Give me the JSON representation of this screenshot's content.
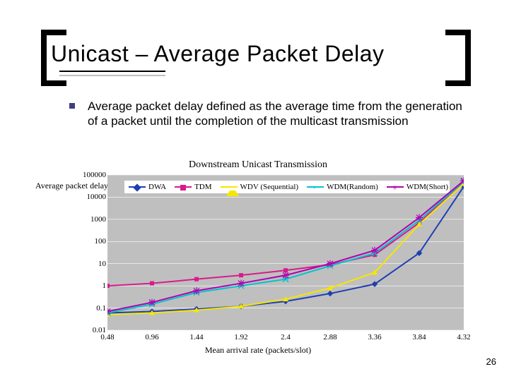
{
  "title": "Unicast – Average Packet Delay",
  "bullet_text": "Average packet delay defined as the average time from the generation of a packet until the completion of the multicast transmission",
  "page_number": "26",
  "chart_data": {
    "type": "line",
    "title": "Downstream Unicast Transmission",
    "xlabel": "Mean arrival rate (packets/slot)",
    "ylabel": "Average packet delay(us)",
    "yscale": "log",
    "ylim": [
      0.01,
      100000
    ],
    "yticks": [
      0.01,
      0.1,
      1,
      10,
      100,
      1000,
      10000,
      100000
    ],
    "ytick_labels": [
      "0.01",
      "0.1",
      "1",
      "10",
      "100",
      "1000",
      "10000",
      "100000"
    ],
    "xticks": [
      0.48,
      0.96,
      1.44,
      1.92,
      2.4,
      2.88,
      3.36,
      3.84,
      4.32
    ],
    "xtick_labels": [
      "0.48",
      "0.96",
      "1.44",
      "1.92",
      "2.4",
      "2.88",
      "3.36",
      "3.84",
      "4.32"
    ],
    "x": [
      0.48,
      0.96,
      1.44,
      1.92,
      2.4,
      2.88,
      3.36,
      3.84,
      4.32
    ],
    "series": [
      {
        "name": "DWA",
        "color": "#1f3fb0",
        "marker": "diamond",
        "values": [
          0.06,
          0.07,
          0.09,
          0.12,
          0.2,
          0.45,
          1.2,
          30,
          30000
        ]
      },
      {
        "name": "TDM",
        "color": "#d81b8c",
        "marker": "square",
        "values": [
          1.0,
          1.3,
          2.0,
          3.0,
          5.0,
          9.0,
          25,
          700,
          50000
        ]
      },
      {
        "name": "WDV (Sequential)",
        "color": "#f7e600",
        "marker": "triangle",
        "values": [
          0.05,
          0.06,
          0.08,
          0.12,
          0.25,
          0.8,
          4,
          600,
          40000
        ]
      },
      {
        "name": "WDM(Random)",
        "color": "#00c5c9",
        "marker": "x",
        "values": [
          0.06,
          0.15,
          0.5,
          1.0,
          2.0,
          8,
          30,
          900,
          50000
        ]
      },
      {
        "name": "WDM(Short)",
        "color": "#b100b1",
        "marker": "star",
        "values": [
          0.07,
          0.18,
          0.6,
          1.3,
          3.0,
          10,
          40,
          1200,
          55000
        ]
      }
    ],
    "legend_position": "top-left-inside"
  }
}
